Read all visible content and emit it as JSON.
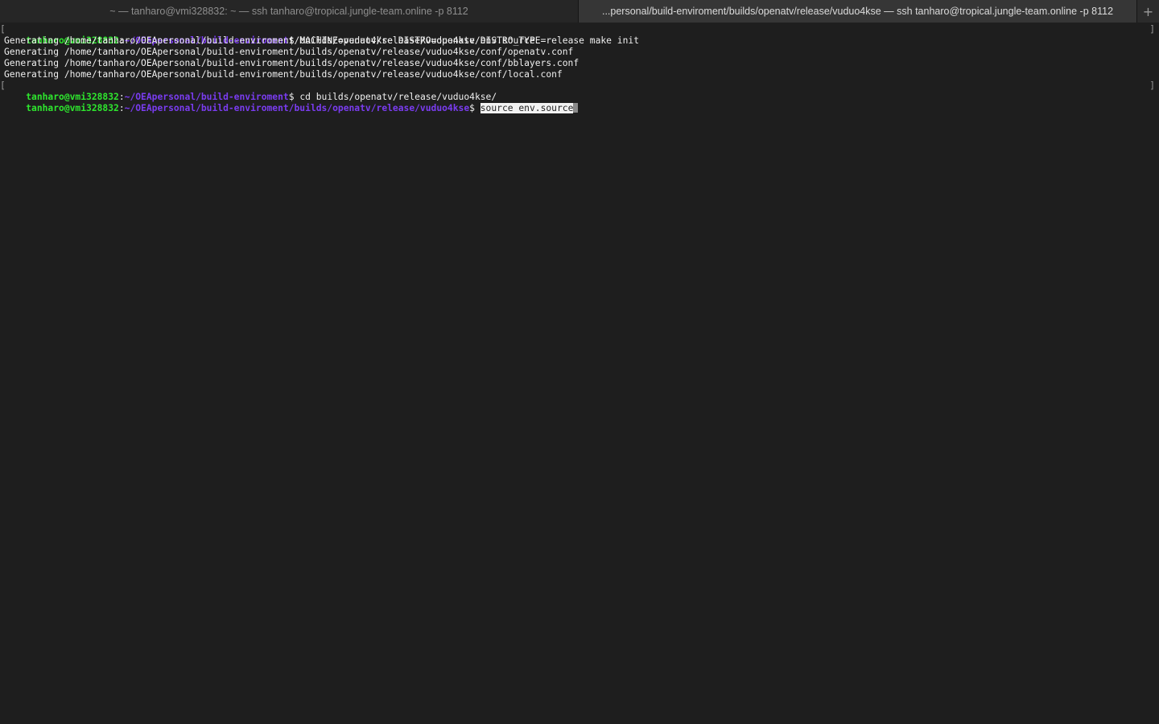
{
  "tabs": [
    {
      "label": "~ — tanharo@vmi328832: ~ — ssh tanharo@tropical.jungle-team.online -p 8112"
    },
    {
      "label": "...personal/build-enviroment/builds/openatv/release/vuduo4kse — ssh tanharo@tropical.jungle-team.online -p 8112"
    }
  ],
  "new_tab_glyph": "+",
  "terminal": {
    "bracket_left": "[",
    "bracket_right": "]",
    "dollar": "$ ",
    "prompt1": {
      "user": "tanharo@vmi328832",
      "colon": ":",
      "path": "~/OEApersonal/build-enviroment",
      "command": "MACHINE=vuduo4kse DISTRO=openatv DISTRO_TYPE=release make init"
    },
    "output": [
      "Generating /home/tanharo/OEApersonal/build-enviroment/builds/openatv/release/vuduo4kse/env.source",
      "Generating /home/tanharo/OEApersonal/build-enviroment/builds/openatv/release/vuduo4kse/conf/openatv.conf",
      "Generating /home/tanharo/OEApersonal/build-enviroment/builds/openatv/release/vuduo4kse/conf/bblayers.conf",
      "Generating /home/tanharo/OEApersonal/build-enviroment/builds/openatv/release/vuduo4kse/conf/local.conf"
    ],
    "prompt2": {
      "user": "tanharo@vmi328832",
      "colon": ":",
      "path": "~/OEApersonal/build-enviroment",
      "command": "cd builds/openatv/release/vuduo4kse/"
    },
    "prompt3": {
      "user": "tanharo@vmi328832",
      "colon": ":",
      "path": "~/OEApersonal/build-enviroment/builds/openatv/release/vuduo4kse",
      "command": "source env.source"
    }
  },
  "colors": {
    "background": "#1e1e1e",
    "prompt_user": "#2ee62e",
    "prompt_path": "#7a3cf0",
    "text": "#f0f0f0"
  }
}
